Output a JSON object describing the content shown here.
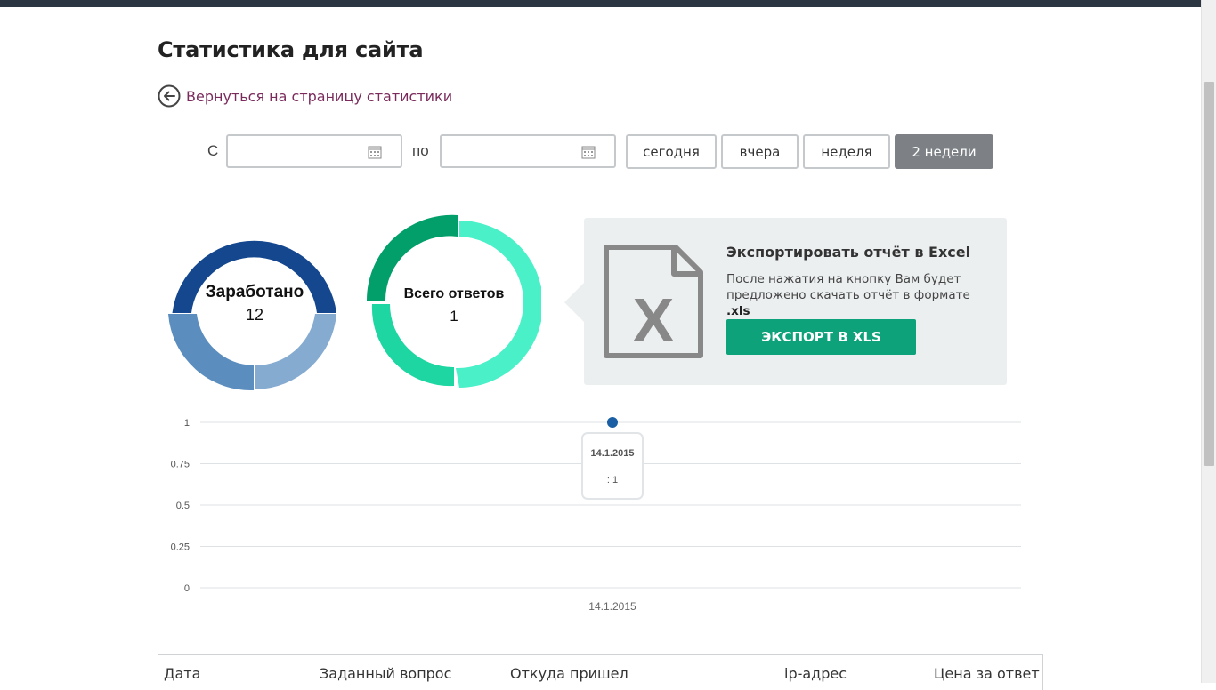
{
  "page": {
    "title": "Статистика для сайта"
  },
  "back": {
    "label": "Вернуться на страницу статистики"
  },
  "filter": {
    "from_label": "С",
    "to_label": "по",
    "from_value": "",
    "to_value": "",
    "periods": [
      "сегодня",
      "вчера",
      "неделя",
      "2 недели"
    ],
    "active_period": "2 недели"
  },
  "stats": {
    "earned": {
      "title": "Заработано",
      "value": "12"
    },
    "answers": {
      "title": "Всего ответов",
      "value": "1"
    }
  },
  "export": {
    "title": "Экспортировать отчёт в Excel",
    "desc_prefix": "После нажатия на кнопку Вам будет предложено скачать отчёт в формате ",
    "desc_format": ".xls",
    "button": "ЭКСПОРТ В XLS",
    "button_color": "#0ea27a"
  },
  "chart_data": {
    "type": "line",
    "x": [
      "14.1.2015"
    ],
    "series": [
      {
        "values": [
          1
        ]
      }
    ],
    "y_ticks": [
      "1",
      "0.75",
      "0.5",
      "0.25",
      "0"
    ],
    "ylim": [
      0,
      1
    ],
    "grid": true,
    "tooltip": {
      "title": "14.1.2015",
      "text": ": 1"
    },
    "point_color": "#1a5fa3"
  },
  "table": {
    "columns": [
      "Дата",
      "Заданный вопрос",
      "Откуда пришел",
      "ip-адрес",
      "Цена за ответ"
    ]
  }
}
